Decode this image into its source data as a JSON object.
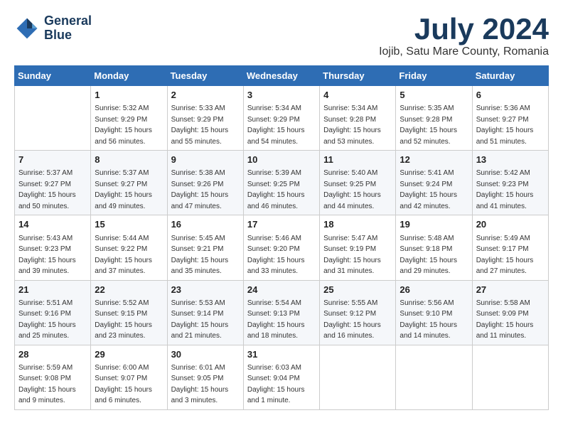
{
  "logo": {
    "line1": "General",
    "line2": "Blue"
  },
  "title": "July 2024",
  "location": "Iojib, Satu Mare County, Romania",
  "weekdays": [
    "Sunday",
    "Monday",
    "Tuesday",
    "Wednesday",
    "Thursday",
    "Friday",
    "Saturday"
  ],
  "weeks": [
    [
      {
        "day": "",
        "info": ""
      },
      {
        "day": "1",
        "info": "Sunrise: 5:32 AM\nSunset: 9:29 PM\nDaylight: 15 hours\nand 56 minutes."
      },
      {
        "day": "2",
        "info": "Sunrise: 5:33 AM\nSunset: 9:29 PM\nDaylight: 15 hours\nand 55 minutes."
      },
      {
        "day": "3",
        "info": "Sunrise: 5:34 AM\nSunset: 9:29 PM\nDaylight: 15 hours\nand 54 minutes."
      },
      {
        "day": "4",
        "info": "Sunrise: 5:34 AM\nSunset: 9:28 PM\nDaylight: 15 hours\nand 53 minutes."
      },
      {
        "day": "5",
        "info": "Sunrise: 5:35 AM\nSunset: 9:28 PM\nDaylight: 15 hours\nand 52 minutes."
      },
      {
        "day": "6",
        "info": "Sunrise: 5:36 AM\nSunset: 9:27 PM\nDaylight: 15 hours\nand 51 minutes."
      }
    ],
    [
      {
        "day": "7",
        "info": "Sunrise: 5:37 AM\nSunset: 9:27 PM\nDaylight: 15 hours\nand 50 minutes."
      },
      {
        "day": "8",
        "info": "Sunrise: 5:37 AM\nSunset: 9:27 PM\nDaylight: 15 hours\nand 49 minutes."
      },
      {
        "day": "9",
        "info": "Sunrise: 5:38 AM\nSunset: 9:26 PM\nDaylight: 15 hours\nand 47 minutes."
      },
      {
        "day": "10",
        "info": "Sunrise: 5:39 AM\nSunset: 9:25 PM\nDaylight: 15 hours\nand 46 minutes."
      },
      {
        "day": "11",
        "info": "Sunrise: 5:40 AM\nSunset: 9:25 PM\nDaylight: 15 hours\nand 44 minutes."
      },
      {
        "day": "12",
        "info": "Sunrise: 5:41 AM\nSunset: 9:24 PM\nDaylight: 15 hours\nand 42 minutes."
      },
      {
        "day": "13",
        "info": "Sunrise: 5:42 AM\nSunset: 9:23 PM\nDaylight: 15 hours\nand 41 minutes."
      }
    ],
    [
      {
        "day": "14",
        "info": "Sunrise: 5:43 AM\nSunset: 9:23 PM\nDaylight: 15 hours\nand 39 minutes."
      },
      {
        "day": "15",
        "info": "Sunrise: 5:44 AM\nSunset: 9:22 PM\nDaylight: 15 hours\nand 37 minutes."
      },
      {
        "day": "16",
        "info": "Sunrise: 5:45 AM\nSunset: 9:21 PM\nDaylight: 15 hours\nand 35 minutes."
      },
      {
        "day": "17",
        "info": "Sunrise: 5:46 AM\nSunset: 9:20 PM\nDaylight: 15 hours\nand 33 minutes."
      },
      {
        "day": "18",
        "info": "Sunrise: 5:47 AM\nSunset: 9:19 PM\nDaylight: 15 hours\nand 31 minutes."
      },
      {
        "day": "19",
        "info": "Sunrise: 5:48 AM\nSunset: 9:18 PM\nDaylight: 15 hours\nand 29 minutes."
      },
      {
        "day": "20",
        "info": "Sunrise: 5:49 AM\nSunset: 9:17 PM\nDaylight: 15 hours\nand 27 minutes."
      }
    ],
    [
      {
        "day": "21",
        "info": "Sunrise: 5:51 AM\nSunset: 9:16 PM\nDaylight: 15 hours\nand 25 minutes."
      },
      {
        "day": "22",
        "info": "Sunrise: 5:52 AM\nSunset: 9:15 PM\nDaylight: 15 hours\nand 23 minutes."
      },
      {
        "day": "23",
        "info": "Sunrise: 5:53 AM\nSunset: 9:14 PM\nDaylight: 15 hours\nand 21 minutes."
      },
      {
        "day": "24",
        "info": "Sunrise: 5:54 AM\nSunset: 9:13 PM\nDaylight: 15 hours\nand 18 minutes."
      },
      {
        "day": "25",
        "info": "Sunrise: 5:55 AM\nSunset: 9:12 PM\nDaylight: 15 hours\nand 16 minutes."
      },
      {
        "day": "26",
        "info": "Sunrise: 5:56 AM\nSunset: 9:10 PM\nDaylight: 15 hours\nand 14 minutes."
      },
      {
        "day": "27",
        "info": "Sunrise: 5:58 AM\nSunset: 9:09 PM\nDaylight: 15 hours\nand 11 minutes."
      }
    ],
    [
      {
        "day": "28",
        "info": "Sunrise: 5:59 AM\nSunset: 9:08 PM\nDaylight: 15 hours\nand 9 minutes."
      },
      {
        "day": "29",
        "info": "Sunrise: 6:00 AM\nSunset: 9:07 PM\nDaylight: 15 hours\nand 6 minutes."
      },
      {
        "day": "30",
        "info": "Sunrise: 6:01 AM\nSunset: 9:05 PM\nDaylight: 15 hours\nand 3 minutes."
      },
      {
        "day": "31",
        "info": "Sunrise: 6:03 AM\nSunset: 9:04 PM\nDaylight: 15 hours\nand 1 minute."
      },
      {
        "day": "",
        "info": ""
      },
      {
        "day": "",
        "info": ""
      },
      {
        "day": "",
        "info": ""
      }
    ]
  ]
}
